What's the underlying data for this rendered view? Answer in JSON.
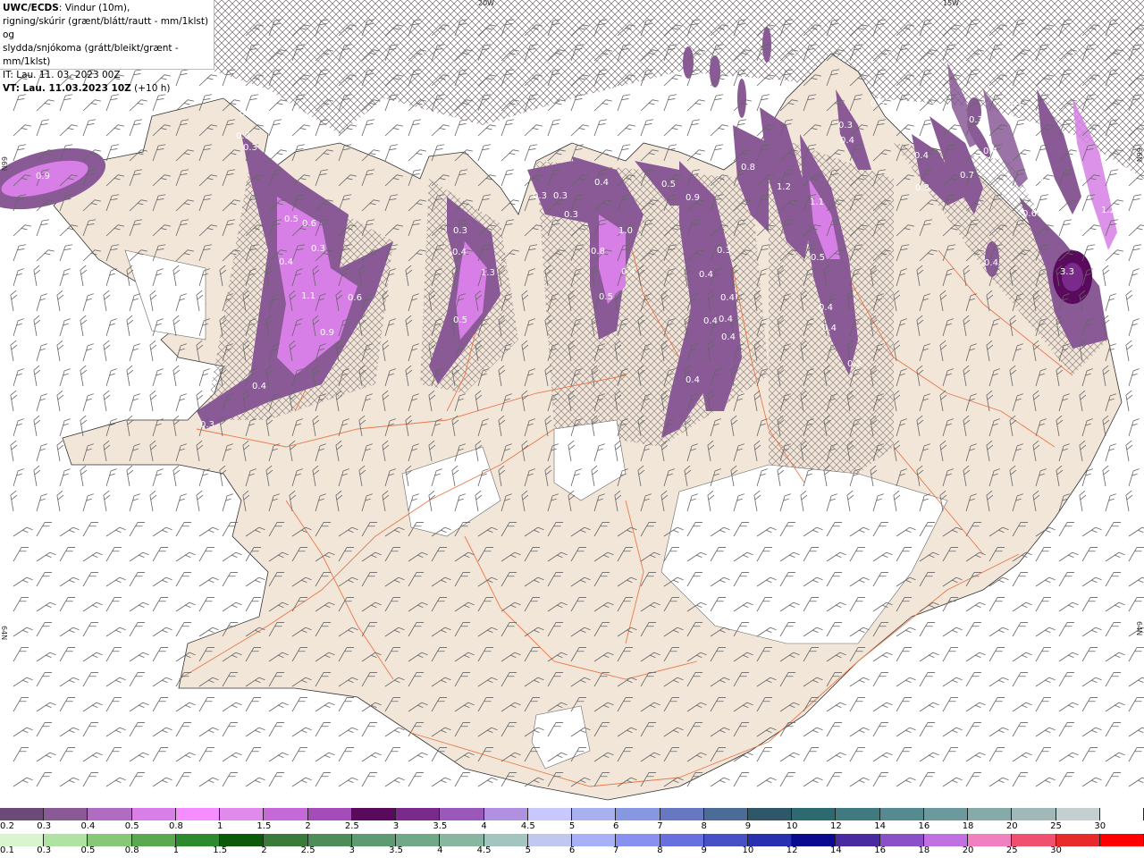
{
  "header": {
    "title_bold": "UWC/ECDS",
    "title_rest": ": Vindur (10m),",
    "line2": "rigning/skúrir (grænt/blátt/rautt - mm/1klst) og",
    "line3": "slydda/snjókoma (grátt/bleikt/grænt - mm/1klst)",
    "it_line": "IT: Lau. 11. 03. 2023 00Z",
    "vt_bold": "VT: Lau. 11.03.2023 10Z",
    "vt_rest": " (+10 h)"
  },
  "map": {
    "edge_labels": [
      "20W",
      "15W",
      "66N",
      "64N",
      "66N",
      "64N"
    ],
    "precip_values": [
      "0.9",
      "0.3",
      "0.3",
      "0.5",
      "0.6",
      "0.4",
      "0.3",
      "1.1",
      "0.9",
      "0.6",
      "0.4",
      "0.3",
      "0.3",
      "0.3",
      "1.3",
      "0.5",
      "0.4",
      "0.3",
      "0.3",
      "0.3",
      "0.4",
      "1.0",
      "0.8",
      "0.4",
      "0.5",
      "0.5",
      "0.9",
      "0.3",
      "0.4",
      "0.4",
      "0.4",
      "0.4",
      "0.4",
      "0.4",
      "0.8",
      "1.2",
      "1.1",
      "0.5",
      "0.4",
      "0.4",
      "0.2",
      "0.6",
      "0.4",
      "0.5",
      "0.3",
      "0.3",
      "0.4",
      "0.7",
      "0.3",
      "0.4",
      "0.3",
      "0.5",
      "3.3",
      "0.4",
      "1.2"
    ],
    "colors": {
      "land": "#f2e6d9",
      "sea": "#ffffff",
      "roads": "#e8794a",
      "hatch": "#7a6e70"
    }
  },
  "colorbar_top": {
    "labels": [
      "0.2",
      "0.3",
      "0.4",
      "0.5",
      "0.8",
      "1",
      "1.5",
      "2",
      "2.5",
      "3",
      "3.5",
      "4",
      "4.5",
      "5",
      "6",
      "7",
      "8",
      "9",
      "10",
      "12",
      "14",
      "16",
      "18",
      "20",
      "25",
      "30"
    ],
    "colors": [
      "#6b4a78",
      "#8a5a96",
      "#b06cc0",
      "#d77fe6",
      "#f58cff",
      "#e08aec",
      "#c46ad8",
      "#a44cb8",
      "#5a0a5c",
      "#7a2a8a",
      "#9a58b8",
      "#b090e0",
      "#c8c8ff",
      "#a8b0f0",
      "#8898e0",
      "#6878c0",
      "#4c6c98",
      "#2e5868",
      "#2c6a70",
      "#3e7a80",
      "#548a90",
      "#6c9a9c",
      "#86aaa8",
      "#a0b8b8",
      "#c4d0d0",
      "#ffffff"
    ]
  },
  "colorbar_bottom": {
    "labels": [
      "0.1",
      "0.3",
      "0.5",
      "0.8",
      "1",
      "1.5",
      "2",
      "2.5",
      "3",
      "3.5",
      "4",
      "4.5",
      "5",
      "6",
      "7",
      "8",
      "9",
      "10",
      "12",
      "14",
      "16",
      "18",
      "20",
      "25",
      "30"
    ],
    "colors": [
      "#d8f5d0",
      "#b0e2a4",
      "#86c878",
      "#5aa850",
      "#2e8a2e",
      "#0a5a0a",
      "#3a7a3a",
      "#4e8c5a",
      "#5e9a72",
      "#70a888",
      "#88b6a0",
      "#a4c4c0",
      "#c0c8f0",
      "#a8b0f8",
      "#8890f0",
      "#6870e0",
      "#4850c8",
      "#2830b0",
      "#0a0a90",
      "#4a2aa0",
      "#8a50c8",
      "#c070e0",
      "#f080c0",
      "#f05070",
      "#e82a2a",
      "#ff0000"
    ]
  }
}
